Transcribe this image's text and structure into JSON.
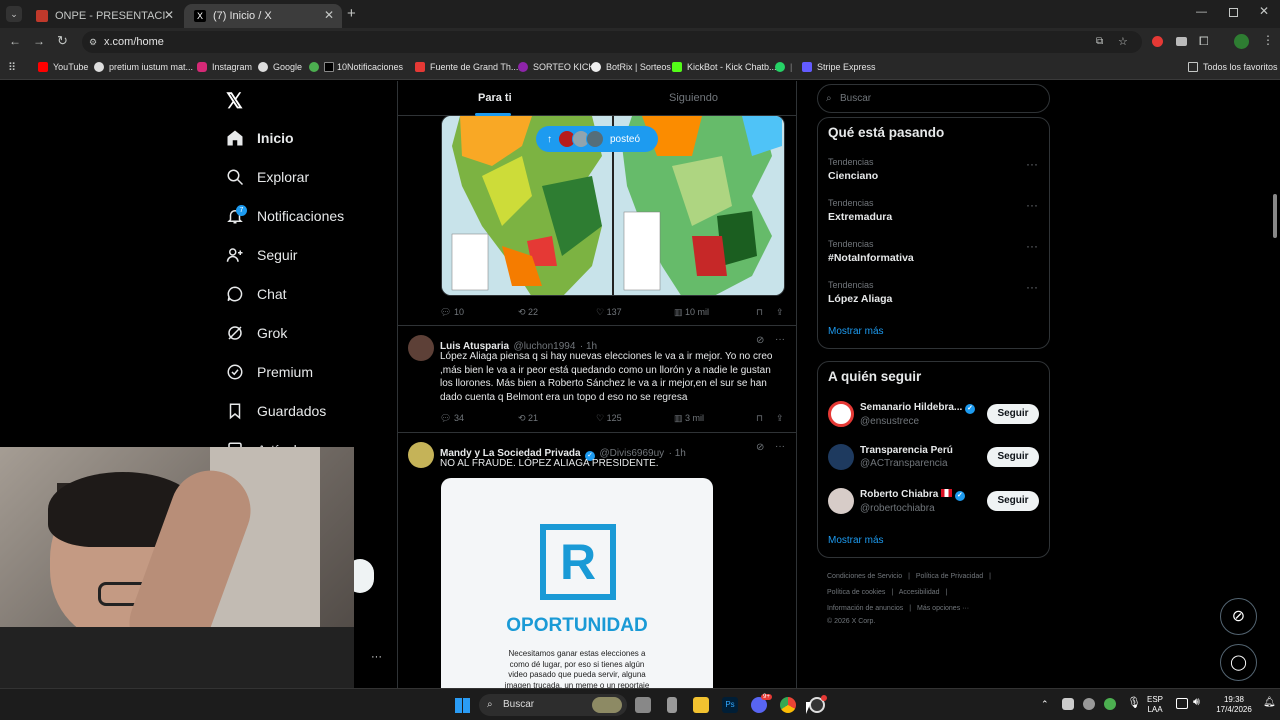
{
  "browser": {
    "tabs": [
      {
        "title": "ONPE - PRESENTACIÓN DE RES",
        "close": "✕"
      },
      {
        "title": "(7) Inicio / X",
        "close": "✕"
      }
    ],
    "new_tab": "+",
    "url": "x.com/home",
    "bookmarks": [
      "YouTube",
      "pretium iustum mat...",
      "Instagram",
      "Google",
      "10Notificaciones",
      "Fuente de Grand Th...",
      "SORTEO KICK",
      "BotRix | Sorteos",
      "KickBot - Kick Chatb...",
      "Stripe Express"
    ],
    "bookmarks_all": "Todos los favoritos"
  },
  "sidebar": {
    "items": [
      {
        "label": "Inicio"
      },
      {
        "label": "Explorar"
      },
      {
        "label": "Notificaciones",
        "badge": "7"
      },
      {
        "label": "Seguir"
      },
      {
        "label": "Chat"
      },
      {
        "label": "Grok"
      },
      {
        "label": "Premium"
      },
      {
        "label": "Guardados"
      },
      {
        "label": "Artículos"
      }
    ],
    "more": "···"
  },
  "feed": {
    "tabs": [
      "Para ti",
      "Siguiendo"
    ],
    "posted_pill": "posteó",
    "post1": {
      "replies": "10",
      "reposts": "22",
      "likes": "137",
      "views": "10 mil"
    },
    "post2": {
      "name": "Luis Atusparia",
      "handle": "@luchon1994",
      "time": "· 1h",
      "text": "López Aliaga piensa q si hay nuevas elecciones le va a ir mejor. Yo no creo ,más bien le va a ir peor está quedando como un llorón y a nadie le gustan los llorones. Más bien a Roberto Sánchez le va a ir mejor,en el sur se han dado cuenta q Belmont  era un topo d eso no se regresa",
      "replies": "34",
      "reposts": "21",
      "likes": "125",
      "views": "3 mil"
    },
    "post3": {
      "name": "Mandy y La Sociedad Privada",
      "handle": "@Divis6969uy",
      "time": "· 1h",
      "text": "NO AL FRAUDE. LÓPEZ ALIAGA PRESIDENTE.",
      "image_logo": "R",
      "image_title": "OPORTUNIDAD",
      "image_text": "Necesitamos ganar estas elecciones a como dé lugar, por eso si tienes algún video pasado que pueda servir, alguna imagen trucada, un meme o un reportaje"
    }
  },
  "right": {
    "search_placeholder": "Buscar",
    "trends_title": "Qué está pasando",
    "trends": [
      {
        "context": "Tendencias",
        "name": "Cienciano"
      },
      {
        "context": "Tendencias",
        "name": "Extremadura"
      },
      {
        "context": "Tendencias",
        "name": "#NotaInformativa"
      },
      {
        "context": "Tendencias",
        "name": "López Aliaga"
      }
    ],
    "show_more": "Mostrar más",
    "follow_title": "A quién seguir",
    "follow": [
      {
        "name": "Semanario Hildebra...",
        "handle": "@ensustrece",
        "button": "Seguir"
      },
      {
        "name": "Transparencia Perú",
        "handle": "@ACTransparencia",
        "button": "Seguir"
      },
      {
        "name": "Roberto Chiabra",
        "handle": "@robertochiabra",
        "button": "Seguir"
      }
    ],
    "follow_more": "Mostrar más",
    "footer": [
      "Condiciones de Servicio",
      "|",
      "Política de Privacidad",
      "|",
      "Política de cookies",
      "|",
      "Accesibilidad",
      "|",
      "Información de anuncios",
      "|",
      "Más opciones ···",
      "© 2026 X Corp."
    ]
  },
  "taskbar": {
    "search": "Buscar",
    "lang1": "ESP",
    "lang2": "LAA",
    "time": "19:38",
    "date": "17/4/2026",
    "discord_badge": "9+"
  },
  "colors": {
    "accent": "#1d9bf0",
    "background": "#000000",
    "border": "#2f3336"
  }
}
